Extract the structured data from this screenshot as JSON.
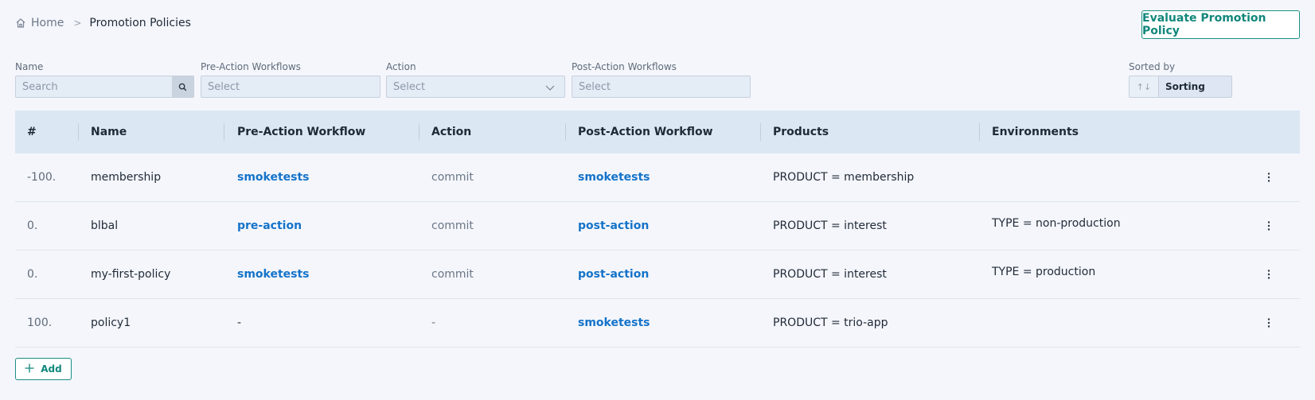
{
  "breadcrumb": {
    "home": "Home",
    "separator": ">",
    "current": "Promotion Policies"
  },
  "header": {
    "evaluate_button": "Evaluate Promotion Policy"
  },
  "filters": {
    "name": {
      "label": "Name",
      "placeholder": "Search"
    },
    "pre_action": {
      "label": "Pre-Action Workflows",
      "placeholder": "Select"
    },
    "action": {
      "label": "Action",
      "placeholder": "Select"
    },
    "post_action": {
      "label": "Post-Action Workflows",
      "placeholder": "Select"
    },
    "sort": {
      "label": "Sorted by",
      "icon": "↑↓",
      "value": "Sorting"
    }
  },
  "table": {
    "headers": [
      "#",
      "Name",
      "Pre-Action Workflow",
      "Action",
      "Post-Action Workflow",
      "Products",
      "Environments"
    ],
    "rows": [
      {
        "num": "-100.",
        "name": "membership",
        "pre": "smoketests",
        "action": "commit",
        "post": "smoketests",
        "products": "PRODUCT = membership",
        "env": ""
      },
      {
        "num": "0.",
        "name": "blbal",
        "pre": "pre-action",
        "action": "commit",
        "post": "post-action",
        "products": "PRODUCT = interest",
        "env": "TYPE = non-production"
      },
      {
        "num": "0.",
        "name": "my-first-policy",
        "pre": "smoketests",
        "action": "commit",
        "post": "post-action",
        "products": "PRODUCT = interest",
        "env": "TYPE = production"
      },
      {
        "num": "100.",
        "name": "policy1",
        "pre": "-",
        "action": "-",
        "post": "smoketests",
        "products": "PRODUCT = trio-app",
        "env": ""
      }
    ]
  },
  "footer": {
    "add_button": "Add"
  },
  "colors": {
    "accent": "#11877c",
    "link": "#1473c9",
    "header_bg": "#dce7f4",
    "page_bg": "#f4f6fb"
  }
}
